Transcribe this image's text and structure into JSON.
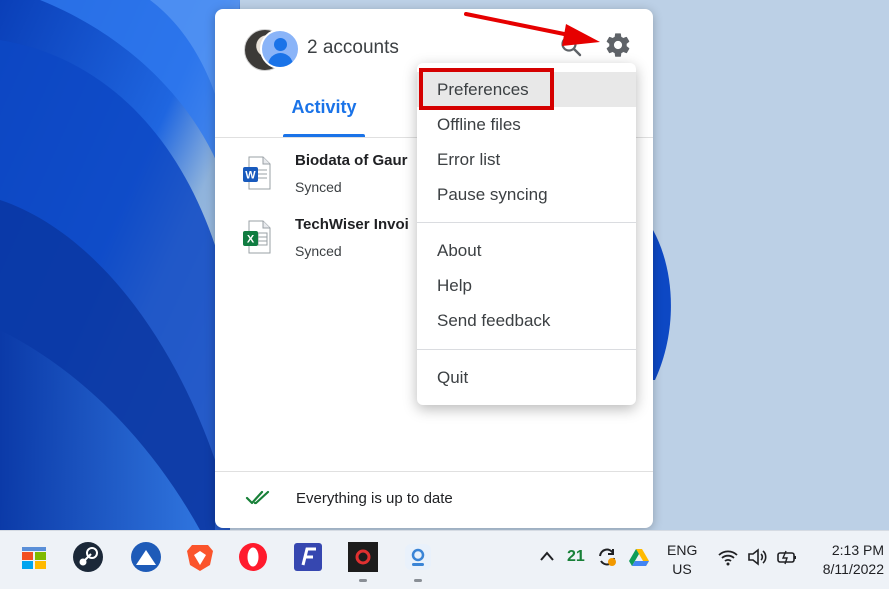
{
  "panel": {
    "accounts_label": "2 accounts",
    "tabs": [
      {
        "label": "Activity",
        "active": true
      }
    ],
    "files": [
      {
        "name": "Biodata of Gaur",
        "status": "Synced",
        "type": "word"
      },
      {
        "name": "TechWiser Invoi",
        "status": "Synced",
        "type": "excel"
      }
    ],
    "footer_status": "Everything is up to date",
    "icons": {
      "search": "search-icon",
      "settings": "gear-icon",
      "sync_ok": "double-check-icon"
    }
  },
  "menu": {
    "group1": [
      "Preferences",
      "Offline files",
      "Error list",
      "Pause syncing"
    ],
    "group2": [
      "About",
      "Help",
      "Send feedback"
    ],
    "group3": [
      "Quit"
    ],
    "highlighted": "Preferences"
  },
  "taskbar": {
    "apps": [
      "start-icon",
      "steam-icon",
      "app-icon",
      "brave-icon",
      "opera-icon",
      "f-app-icon",
      "media-icon",
      "app2-icon"
    ],
    "tray_count": "21",
    "language_line1": "ENG",
    "language_line2": "US",
    "time": "2:13 PM",
    "date": "8/11/2022"
  },
  "colors": {
    "accent": "#1a73e8",
    "highlight_red": "#d50000",
    "sync_green": "#188038"
  }
}
